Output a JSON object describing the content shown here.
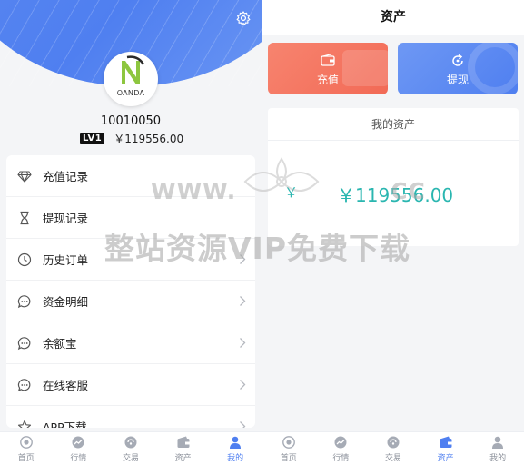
{
  "left": {
    "avatar_brand": "OANDA",
    "user_id": "10010050",
    "level": "LV1",
    "balance": "￥119556.00",
    "menu": [
      {
        "label": "充值记录",
        "icon": "diamond-icon"
      },
      {
        "label": "提现记录",
        "icon": "hourglass-icon"
      },
      {
        "label": "历史订单",
        "icon": "clock-icon"
      },
      {
        "label": "资金明细",
        "icon": "chat-bubble-icon"
      },
      {
        "label": "余额宝",
        "icon": "chat-bubble-icon"
      },
      {
        "label": "在线客服",
        "icon": "chat-bubble-icon"
      },
      {
        "label": "APP下载",
        "icon": "star-icon"
      }
    ]
  },
  "right": {
    "title": "资产",
    "recharge_label": "充值",
    "withdraw_label": "提现",
    "assets_title": "我的资产",
    "currency_symbol": "￥",
    "total_assets": "￥119556.00"
  },
  "tabbar": [
    {
      "label": "首页",
      "icon": "home-icon"
    },
    {
      "label": "行情",
      "icon": "chart-icon"
    },
    {
      "label": "交易",
      "icon": "trade-icon"
    },
    {
      "label": "资产",
      "icon": "wallet-icon"
    },
    {
      "label": "我的",
      "icon": "user-icon"
    }
  ],
  "left_active_tab": 4,
  "right_active_tab": 3,
  "watermark": {
    "url": "WWW.",
    "url_tail": "CC",
    "text": "整站资源VIP免费下载"
  },
  "colors": {
    "brand_blue": "#4f7ff0",
    "recharge_red": "#f26a56",
    "asset_teal": "#2ab6b0",
    "inactive_tab": "#8a8f99"
  }
}
